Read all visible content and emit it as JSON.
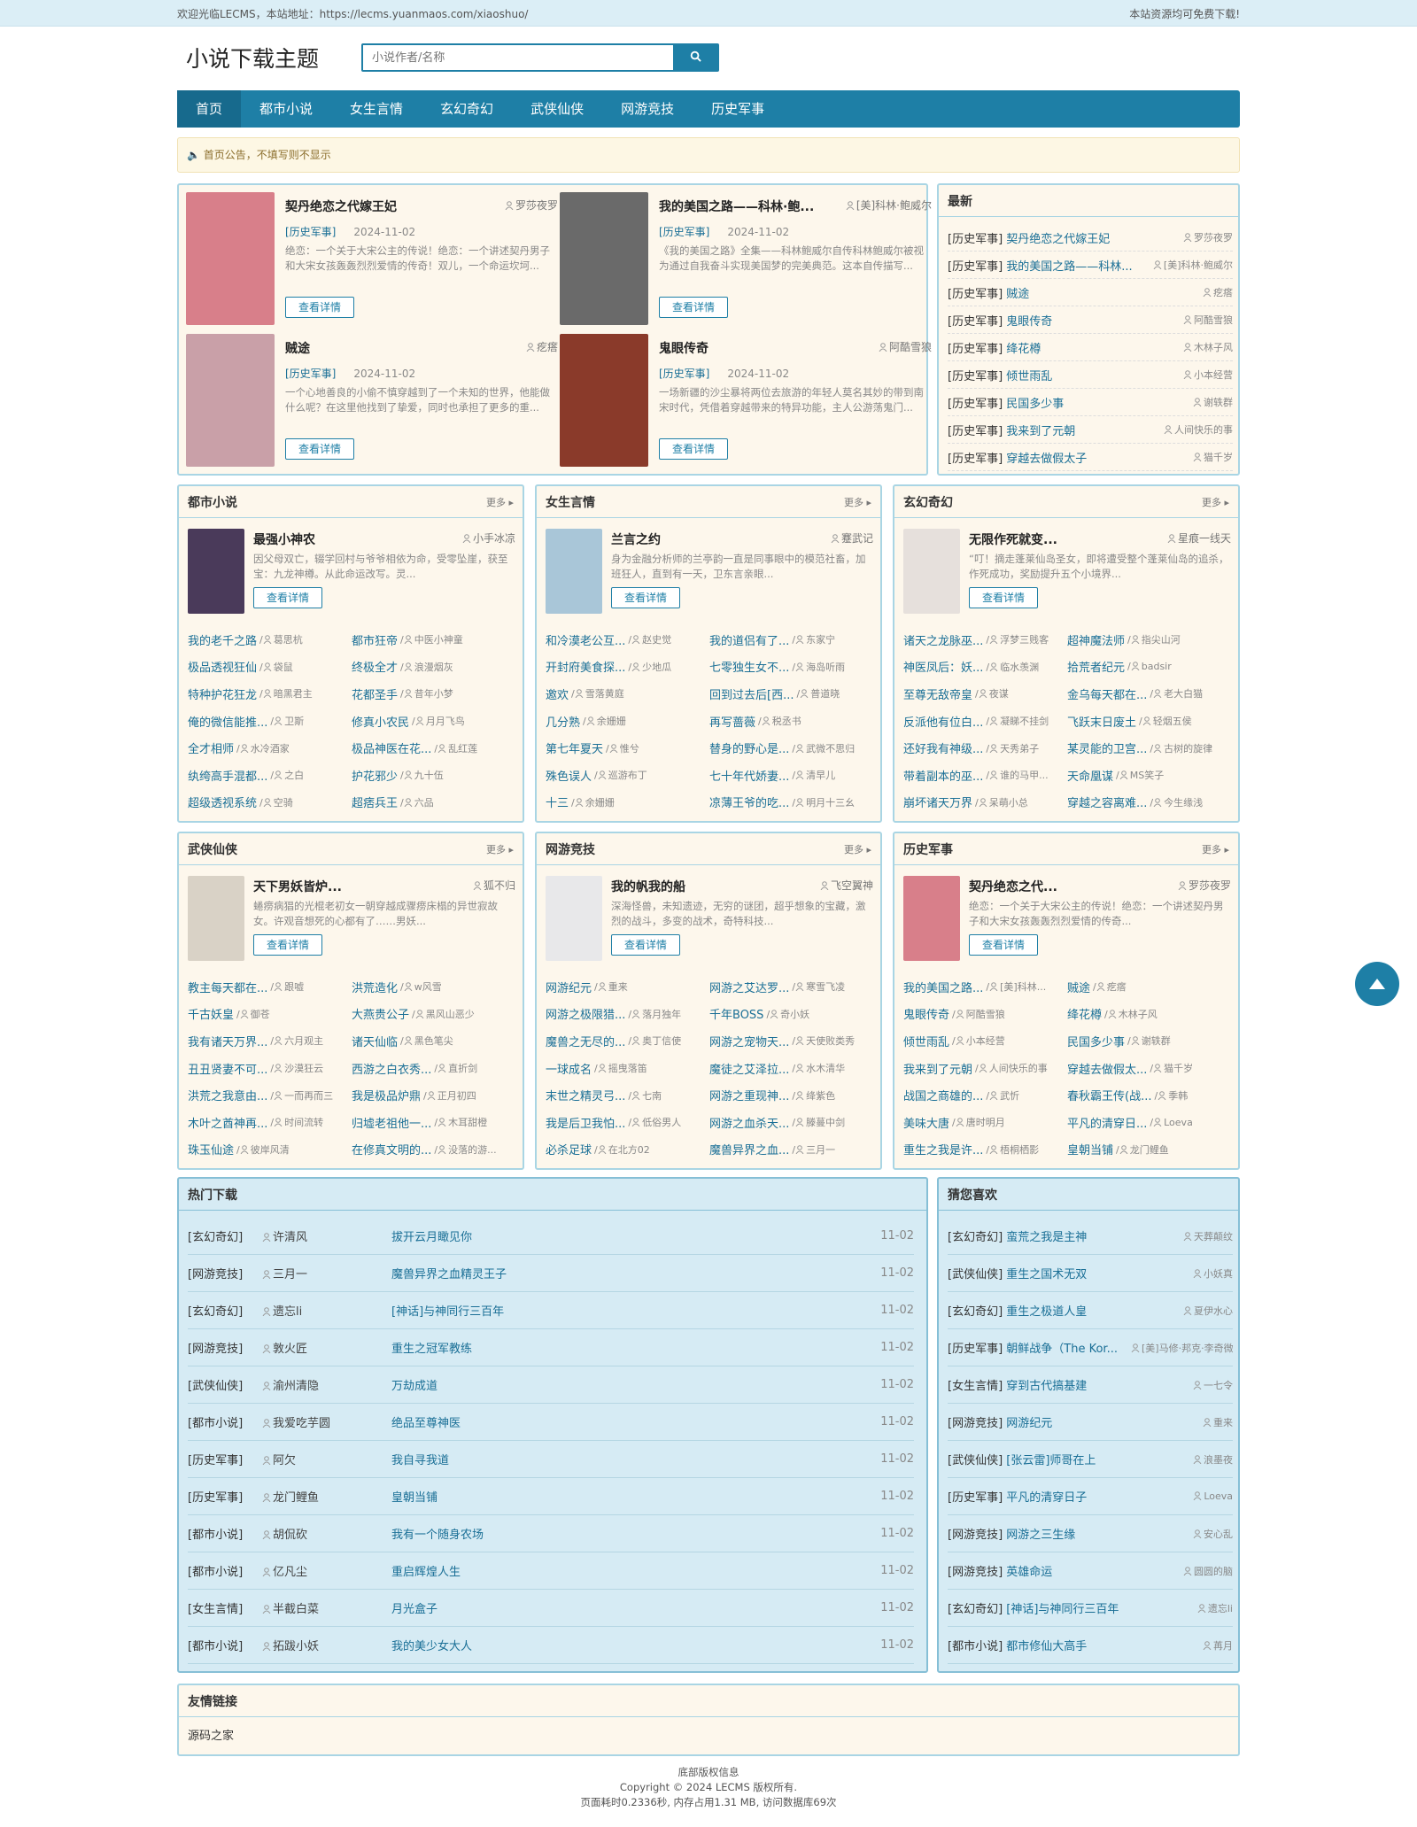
{
  "topbar": {
    "welcome": "欢迎光临LECMS，本站地址：https://lecms.yuanmaos.com/xiaoshuo/",
    "right": "本站资源均可免费下载!"
  },
  "header": {
    "logo": "小说下载主题",
    "search_placeholder": "小说作者/名称"
  },
  "nav": [
    "首页",
    "都市小说",
    "女生言情",
    "玄幻奇幻",
    "武侠仙侠",
    "网游竞技",
    "历史军事"
  ],
  "notice": "首页公告，不填写则不显示",
  "featured": [
    {
      "title": "契丹绝恋之代嫁王妃",
      "author": "罗莎夜罗",
      "cat": "[历史军事]",
      "date": "2024-11-02",
      "desc": "绝恋：一个关于大宋公主的传说！绝恋：一个讲述契丹男子和大宋女孩轰轰烈烈爱情的传奇！双儿，一个命运坎坷...",
      "btn": "查看详情",
      "color": "#d87f8a"
    },
    {
      "title": "我的美国之路——科林·鲍...",
      "author": "[美]科林·鲍威尔",
      "cat": "[历史军事]",
      "date": "2024-11-02",
      "desc": "《我的美国之路》全集——科林鲍威尔自传科林鲍威尔被视为通过自我奋斗实现美国梦的完美典范。这本自传描写...",
      "btn": "查看详情",
      "color": "#6a6a6a"
    },
    {
      "title": "贼途",
      "author": "疙瘩",
      "cat": "[历史军事]",
      "date": "2024-11-02",
      "desc": "一个心地善良的小偷不慎穿越到了一个未知的世界，他能做什么呢？在这里他找到了挚爱，同时也承担了更多的重...",
      "btn": "查看详情",
      "color": "#c9a0a8"
    },
    {
      "title": "鬼眼传奇",
      "author": "阿酷雪狼",
      "cat": "[历史军事]",
      "date": "2024-11-02",
      "desc": "一场新疆的沙尘暴将两位去旅游的年轻人莫名其妙的带到南宋时代，凭借着穿越带来的特异功能，主人公游荡鬼门...",
      "btn": "查看详情",
      "color": "#8a3a2a"
    }
  ],
  "latest": {
    "title": "最新",
    "items": [
      {
        "cat": "[历史军事]",
        "t": "契丹绝恋之代嫁王妃",
        "a": "罗莎夜罗"
      },
      {
        "cat": "[历史军事]",
        "t": "我的美国之路——科林...",
        "a": "[美]科林·鲍威尔"
      },
      {
        "cat": "[历史军事]",
        "t": "贼途",
        "a": "疙瘩"
      },
      {
        "cat": "[历史军事]",
        "t": "鬼眼传奇",
        "a": "阿酷雪狼"
      },
      {
        "cat": "[历史军事]",
        "t": "绛花樽",
        "a": "木林子风"
      },
      {
        "cat": "[历史军事]",
        "t": "倾世雨乱",
        "a": "小本经营"
      },
      {
        "cat": "[历史军事]",
        "t": "民国多少事",
        "a": "谢轶群"
      },
      {
        "cat": "[历史军事]",
        "t": "我来到了元朝",
        "a": "人间快乐的事"
      },
      {
        "cat": "[历史军事]",
        "t": "穿越去做假太子",
        "a": "猫千岁"
      }
    ]
  },
  "more": "更多",
  "cats": [
    {
      "name": "都市小说",
      "feat": {
        "t": "最强小神农",
        "a": "小手冰凉",
        "d": "因父母双亡，辍学回村与爷爷相依为命，受零坠崖，获至宝：九龙神樽。从此命运改写。灵...",
        "color": "#4a3a5a"
      },
      "items": [
        [
          "我的老千之路",
          "葛思杭"
        ],
        [
          "都市狂帝",
          "中医小神童"
        ],
        [
          "极品透视狂仙",
          "袋鼠"
        ],
        [
          "终极全才",
          "浪漫烟灰"
        ],
        [
          "特种护花狂龙",
          "暗黑君主"
        ],
        [
          "花都圣手",
          "昔年小梦"
        ],
        [
          "俺的微信能推...",
          "卫斯"
        ],
        [
          "修真小农民",
          "月月飞鸟"
        ],
        [
          "全才相师",
          "水冷酒家"
        ],
        [
          "极品神医在花...",
          "乱红莲"
        ],
        [
          "纨绔高手混都...",
          "之白"
        ],
        [
          "护花邪少",
          "九十伍"
        ],
        [
          "超级透视系统",
          "空骑"
        ],
        [
          "超痞兵王",
          "六品"
        ]
      ]
    },
    {
      "name": "女生言情",
      "feat": {
        "t": "兰言之约",
        "a": "蹇武记",
        "d": "身为金融分析师的兰亭韵一直是同事眼中的模范社畜，加班狂人，直到有一天，卫东言亲眼...",
        "color": "#a9c6d8"
      },
      "items": [
        [
          "和冷漠老公互...",
          "赵史觉"
        ],
        [
          "我的道侣有了...",
          "东家宁"
        ],
        [
          "开封府美食探...",
          "少地瓜"
        ],
        [
          "七零独生女不...",
          "海岛听雨"
        ],
        [
          "邀欢",
          "雪落黄庭"
        ],
        [
          "回到过去后[西...",
          "普道晓"
        ],
        [
          "几分熟",
          "余姗姗"
        ],
        [
          "再写蔷薇",
          "税丞书"
        ],
        [
          "第七年夏天",
          "惟兮"
        ],
        [
          "替身的野心是...",
          "武微不思归"
        ],
        [
          "殊色误人",
          "巡游布丁"
        ],
        [
          "七十年代娇妻...",
          "清早儿"
        ],
        [
          "十三",
          "余姗姗"
        ],
        [
          "凉薄王爷的吃...",
          "明月十三幺"
        ]
      ]
    },
    {
      "name": "玄幻奇幻",
      "feat": {
        "t": "无限作死就变...",
        "a": "星痕一线天",
        "d": "“叮！摘走蓬莱仙岛圣女，即将遭受整个蓬莱仙岛的追杀，作死成功，奖励提升五个小境界...",
        "color": "#e6e0dc"
      },
      "items": [
        [
          "诸天之龙脉巫...",
          "浮梦三贱客"
        ],
        [
          "超神魔法师",
          "指尖山河"
        ],
        [
          "神医凤后：妖...",
          "临水羡渊"
        ],
        [
          "拾荒者纪元",
          "badsir"
        ],
        [
          "至尊无敌帝皇",
          "夜谋"
        ],
        [
          "金乌每天都在...",
          "老大白猫"
        ],
        [
          "反派他有位白...",
          "凝睇不挂剑"
        ],
        [
          "飞跃末日废土",
          "轻烟五侯"
        ],
        [
          "还好我有神级...",
          "天秀弟子"
        ],
        [
          "某灵能的卫宫...",
          "古树的旋律"
        ],
        [
          "带着副本的巫...",
          "谁的马甲..."
        ],
        [
          "天命凰谋",
          "MS笑子"
        ],
        [
          "崩坏诸天万界",
          "呆萌小总"
        ],
        [
          "穿越之容离难...",
          "今生缘浅"
        ]
      ]
    },
    {
      "name": "武侠仙侠",
      "feat": {
        "t": "天下男妖皆炉...",
        "a": "狐不归",
        "d": "蜷痨病猖的光棍老初女一朝穿越成骤痨床榻的异世寂故女。许观音想死的心都有了……男妖...",
        "color": "#d9d2c6"
      },
      "items": [
        [
          "教主每天都在...",
          "跟嘘"
        ],
        [
          "洪荒造化",
          "w风雪"
        ],
        [
          "千古妖皇",
          "御苍"
        ],
        [
          "大燕贵公子",
          "黑风山恶少"
        ],
        [
          "我有诸天万界...",
          "六月观主"
        ],
        [
          "诸天仙临",
          "黑色笔尖"
        ],
        [
          "丑丑贤妻不可...",
          "沙漠狂云"
        ],
        [
          "西游之白衣秀...",
          "直折剑"
        ],
        [
          "洪荒之我意由...",
          "一而再而三"
        ],
        [
          "我是极品炉鼎",
          "正月初四"
        ],
        [
          "木叶之酋神再...",
          "时间流转"
        ],
        [
          "归墟老祖他一...",
          "木耳甜橙"
        ],
        [
          "珠玉仙途",
          "彼岸风清"
        ],
        [
          "在修真文明的...",
          "没落的游..."
        ]
      ]
    },
    {
      "name": "网游竞技",
      "feat": {
        "t": "我的帆我的船",
        "a": "飞空翼神",
        "d": "深海怪兽，未知遗迹，无穷的谜团，超乎想象的宝藏，激烈的战斗，多变的战术，奇特科技...",
        "color": "#e8e8ea"
      },
      "items": [
        [
          "网游纪元",
          "重来"
        ],
        [
          "网游之艾达罗...",
          "寒雪飞凌"
        ],
        [
          "网游之极限猎...",
          "落月独年"
        ],
        [
          "千年BOSS",
          "奇小妖"
        ],
        [
          "魔兽之无尽的...",
          "奥丁信使"
        ],
        [
          "网游之宠物天...",
          "天使败类秀"
        ],
        [
          "一球成名",
          "摇曳落笛"
        ],
        [
          "魔徒之艾泽拉...",
          "水木清华"
        ],
        [
          "末世之精灵弓...",
          "七南"
        ],
        [
          "网游之重现神...",
          "绛紫色"
        ],
        [
          "我是后卫我怕...",
          "低俗男人"
        ],
        [
          "网游之血杀天...",
          "滕蔓中剑"
        ],
        [
          "必杀足球",
          "在北方02"
        ],
        [
          "魔兽异界之血...",
          "三月一"
        ]
      ]
    },
    {
      "name": "历史军事",
      "feat": {
        "t": "契丹绝恋之代...",
        "a": "罗莎夜罗",
        "d": "绝恋：一个关于大宋公主的传说！绝恋：一个讲述契丹男子和大宋女孩轰轰烈烈爱情的传奇...",
        "color": "#d87f8a"
      },
      "items": [
        [
          "我的美国之路...",
          "[美]科林..."
        ],
        [
          "贼途",
          "疙瘩"
        ],
        [
          "鬼眼传奇",
          "阿酷雪狼"
        ],
        [
          "绛花樽",
          "木林子风"
        ],
        [
          "倾世雨乱",
          "小本经营"
        ],
        [
          "民国多少事",
          "谢轶群"
        ],
        [
          "我来到了元朝",
          "人间快乐的事"
        ],
        [
          "穿越去做假太...",
          "猫千岁"
        ],
        [
          "战国之商雄的...",
          "武忻"
        ],
        [
          "春秋霸王传(战...",
          "季韩"
        ],
        [
          "美味大唐",
          "唐时明月"
        ],
        [
          "平凡的清穿日...",
          "Loeva"
        ],
        [
          "重生之我是许...",
          "梧桐栖影"
        ],
        [
          "皇朝当铺",
          "龙门鲤鱼"
        ]
      ]
    }
  ],
  "detail_btn": "查看详情",
  "hot": {
    "title": "热门下载",
    "rows": [
      [
        "[玄幻奇幻]",
        "许清风",
        "拔开云月瞰见你",
        "11-02"
      ],
      [
        "[网游竞技]",
        "三月一",
        "魔兽异界之血精灵王子",
        "11-02"
      ],
      [
        "[玄幻奇幻]",
        "遗忘li",
        "[神话]与神同行三百年",
        "11-02"
      ],
      [
        "[网游竞技]",
        "敦火匠",
        "重生之冠军教练",
        "11-02"
      ],
      [
        "[武侠仙侠]",
        "渝州清隐",
        "万劫成道",
        "11-02"
      ],
      [
        "[都市小说]",
        "我爱吃芋圆",
        "绝品至尊神医",
        "11-02"
      ],
      [
        "[历史军事]",
        "阿欠",
        "我自寻我道",
        "11-02"
      ],
      [
        "[历史军事]",
        "龙门鲤鱼",
        "皇朝当铺",
        "11-02"
      ],
      [
        "[都市小说]",
        "胡侃砍",
        "我有一个随身农场",
        "11-02"
      ],
      [
        "[都市小说]",
        "亿凡尘",
        "重启辉煌人生",
        "11-02"
      ],
      [
        "[女生言情]",
        "半截白菜",
        "月光盒子",
        "11-02"
      ],
      [
        "[都市小说]",
        "拓跋小妖",
        "我的美少女大人",
        "11-02"
      ]
    ]
  },
  "guess": {
    "title": "猜您喜欢",
    "rows": [
      [
        "[玄幻奇幻]",
        "蛮荒之我是主神",
        "天葬颠纹"
      ],
      [
        "[武侠仙侠]",
        "重生之国术无双",
        "小妖真"
      ],
      [
        "[玄幻奇幻]",
        "重生之极道人皇",
        "夏伊水心"
      ],
      [
        "[历史军事]",
        "朝鲜战争（The Kor...",
        "[美]马修·邦克·李奇微"
      ],
      [
        "[女生言情]",
        "穿到古代搞基建",
        "一七令"
      ],
      [
        "[网游竞技]",
        "网游纪元",
        "重来"
      ],
      [
        "[武侠仙侠]",
        "[张云雷]师哥在上",
        "浪墨夜"
      ],
      [
        "[历史军事]",
        "平凡的清穿日子",
        "Loeva"
      ],
      [
        "[网游竞技]",
        "网游之三生缘",
        "安心乱"
      ],
      [
        "[网游竞技]",
        "英雄命运",
        "圆圆的脑"
      ],
      [
        "[玄幻奇幻]",
        "[神话]与神同行三百年",
        "遗忘li"
      ],
      [
        "[都市小说]",
        "都市修仙大高手",
        "苒月"
      ]
    ]
  },
  "links": {
    "title": "友情链接",
    "items": [
      "源码之家"
    ]
  },
  "footer": {
    "l1": "底部版权信息",
    "l2": "Copyright © 2024 LECMS 版权所有.",
    "l3": "页面耗时0.2336秒, 内存占用1.31 MB, 访问数据库69次"
  }
}
